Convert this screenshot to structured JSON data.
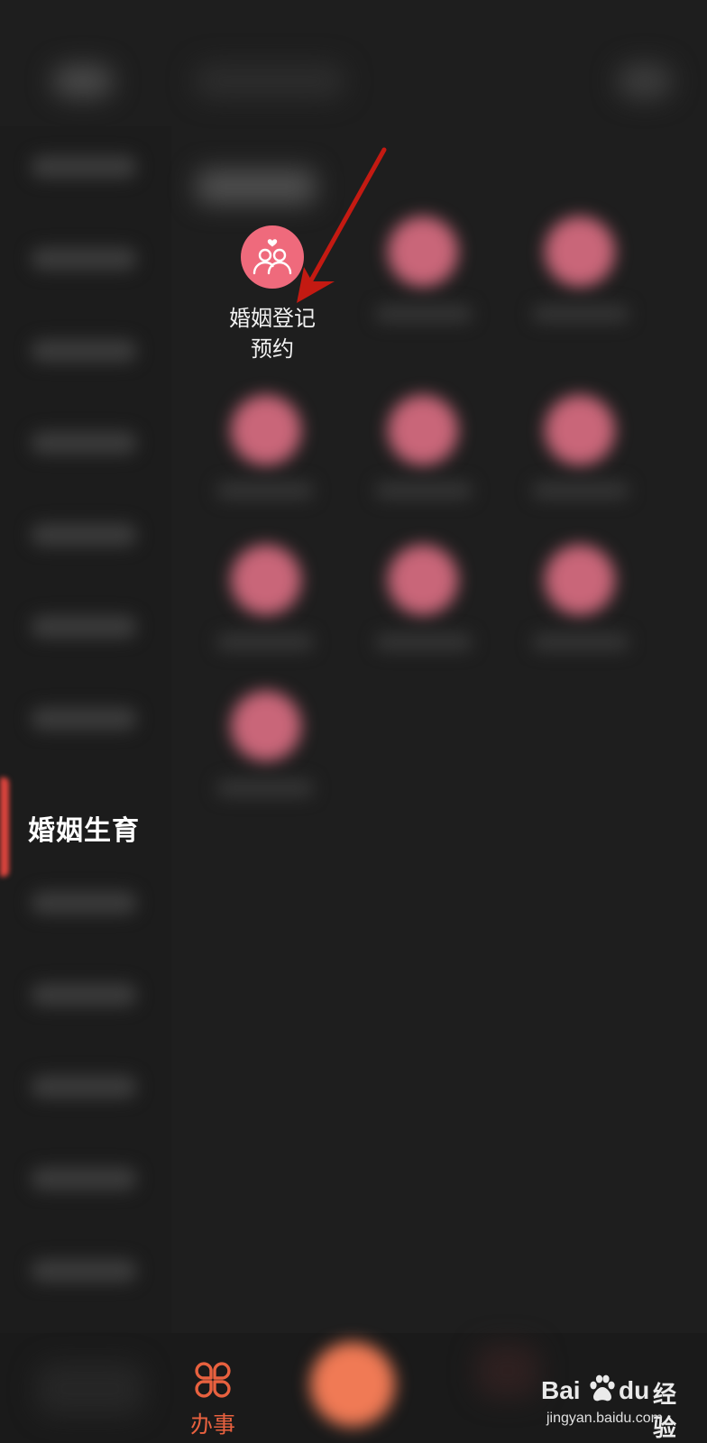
{
  "sidebar": {
    "active_category": "婚姻生育"
  },
  "grid": {
    "focused_item": {
      "label_line1": "婚姻登记",
      "label_line2": "预约",
      "icon": "couple-heart-icon"
    }
  },
  "bottom_nav": {
    "active_tab_label": "办事",
    "active_tab_icon": "four-petal-grid-icon"
  },
  "watermark": {
    "brand_bai": "Bai",
    "brand_du": "du",
    "brand_cn": "经验",
    "url": "jingyan.baidu.com"
  },
  "colors": {
    "accent_red": "#e0453e",
    "icon_pink": "#ef6a7c",
    "nav_active": "#e8613f",
    "arrow_red": "#c41a12"
  }
}
